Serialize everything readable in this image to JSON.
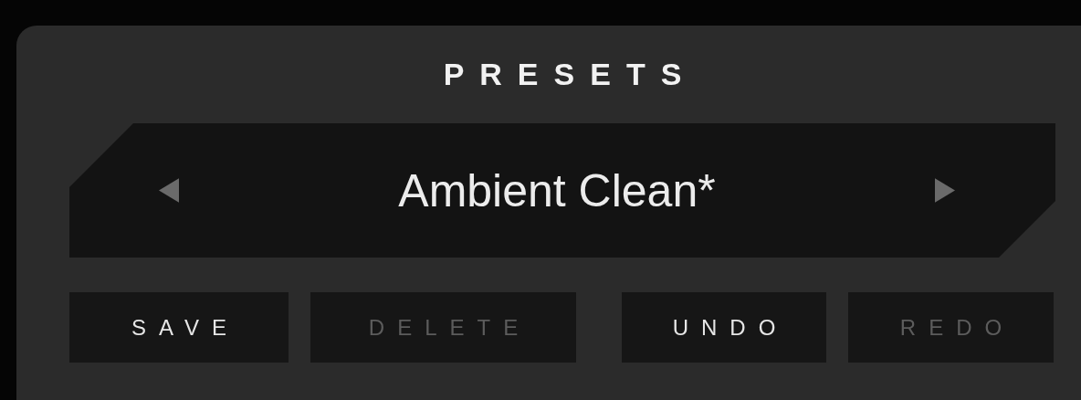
{
  "title": "PRESETS",
  "preset": {
    "name": "Ambient Clean*"
  },
  "buttons": [
    {
      "label": "SAVE",
      "disabled": false
    },
    {
      "label": "DELETE",
      "disabled": true
    },
    {
      "label": "UNDO",
      "disabled": false
    },
    {
      "label": "REDO",
      "disabled": true
    }
  ]
}
